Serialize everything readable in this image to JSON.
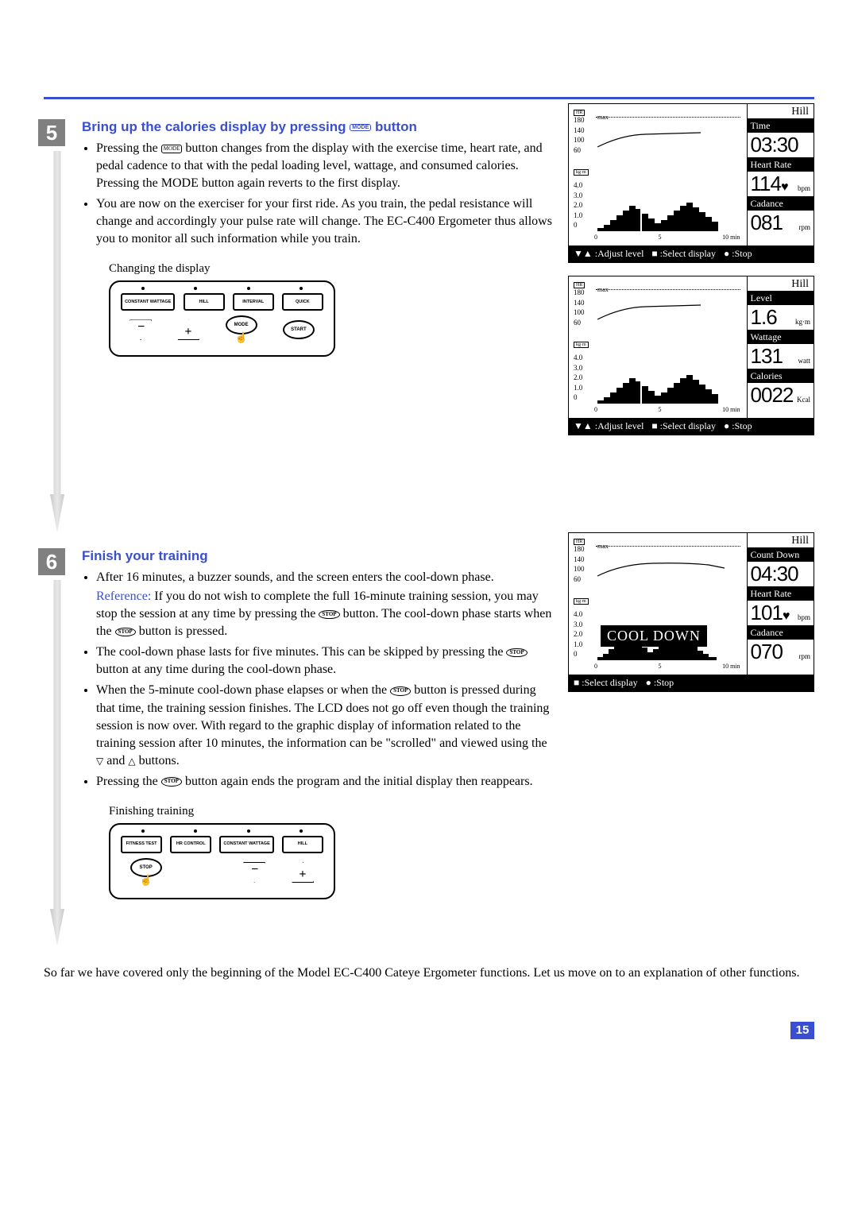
{
  "step5": {
    "number": "5",
    "title_pre": "Bring up the calories display by pressing ",
    "title_post": " button",
    "mode_icon": "MODE",
    "bullets": [
      "Pressing the MODE button changes from the display with the exercise time, heart rate, and pedal cadence to that with the pedal loading level, wattage, and consumed calories. Pressing the MODE button again reverts to the first display.",
      "You are now on the exerciser for your first ride. As you train, the pedal resistance will change and accordingly your pulse rate will change. The EC-C400 Ergometer thus allows you to monitor all such information while you train."
    ],
    "panel_caption": "Changing the display",
    "panel_top_buttons": [
      "CONSTANT WATTAGE",
      "HILL",
      "INTERVAL",
      "QUICK"
    ],
    "panel_bottom_buttons": [
      "−",
      "+",
      "MODE",
      "START"
    ]
  },
  "step6": {
    "number": "6",
    "title": "Finish your training",
    "bullet1": "After 16 minutes, a buzzer sounds, and the screen enters the cool-down phase.",
    "ref_label": "Reference:",
    "ref_text": " If you do not wish to complete the full 16-minute training session, you may stop the session at any time by pressing the STOP button. The cool-down phase starts when the STOP button is pressed.",
    "bullet2": "The cool-down phase lasts for five minutes. This can be skipped by pressing the STOP button at any time during the cool-down phase.",
    "bullet3": "When the 5-minute cool-down phase elapses or when the STOP button is pressed during that time, the training session finishes. The LCD does not go off even though the training session is now over. With regard to the graphic display of information related to the training session after 10 minutes, the information can be \"scrolled\" and viewed using the ▽ and △ buttons.",
    "bullet4": "Pressing the STOP button again ends the program and the initial display then reappears.",
    "panel_caption": "Finishing training",
    "panel_top_buttons": [
      "FITNESS TEST",
      "HR CONTROL",
      "CONSTANT WATTAGE",
      "HILL"
    ],
    "panel_stop": "STOP"
  },
  "lcd1": {
    "mode": "Hill",
    "hr_label": "HR",
    "max_label": "max",
    "hr_ticks": [
      "180",
      "140",
      "100",
      "60"
    ],
    "kgm_label": "kg·m",
    "kgm_ticks": [
      "4.0",
      "3.0",
      "2.0",
      "1.0",
      "0"
    ],
    "x_ticks": [
      "0",
      "5",
      "10"
    ],
    "x_unit": "min",
    "metrics": [
      {
        "label": "Time",
        "value": "03:30",
        "unit": ""
      },
      {
        "label": "Heart Rate",
        "value": "114",
        "unit": "bpm",
        "heart": true
      },
      {
        "label": "Cadance",
        "value": "081",
        "unit": "rpm"
      }
    ],
    "footer": [
      "▼▲ :Adjust level",
      "■ :Select display",
      "● :Stop"
    ]
  },
  "lcd2": {
    "mode": "Hill",
    "metrics": [
      {
        "label": "Level",
        "value": "1.6",
        "unit": "kg·m"
      },
      {
        "label": "Wattage",
        "value": "131",
        "unit": "watt"
      },
      {
        "label": "Calories",
        "value": "0022",
        "unit": "Kcal"
      }
    ],
    "footer": [
      "▼▲ :Adjust level",
      "■ :Select display",
      "● :Stop"
    ]
  },
  "lcd3": {
    "mode": "Hill",
    "cooldown": "COOL DOWN",
    "metrics": [
      {
        "label": "Count Down",
        "value": "04:30",
        "unit": ""
      },
      {
        "label": "Heart Rate",
        "value": "101",
        "unit": "bpm",
        "heart": true
      },
      {
        "label": "Cadance",
        "value": "070",
        "unit": "rpm"
      }
    ],
    "footer": [
      "■ :Select display",
      "● :Stop"
    ]
  },
  "closing": "So far we have covered only the beginning of the Model EC-C400 Cateye Ergometer functions. Let us move on to an explanation of other functions.",
  "page_number": "15",
  "chart_data": [
    {
      "type": "line+bar",
      "title": "HR and load vs time (display 1)",
      "hr_axis": {
        "ticks": [
          60,
          100,
          140,
          180
        ],
        "label": "HR"
      },
      "load_axis": {
        "ticks": [
          0,
          1.0,
          2.0,
          3.0,
          4.0
        ],
        "label": "kg·m"
      },
      "x_axis": {
        "ticks": [
          0,
          5,
          10
        ],
        "unit": "min"
      },
      "hr_series": [
        90,
        100,
        108,
        114,
        116,
        118,
        120
      ],
      "load_bars": [
        0.5,
        0.8,
        1.2,
        1.6,
        2.0,
        2.4,
        2.6,
        2.2,
        1.8,
        1.4,
        1.0,
        1.2,
        1.6,
        2.0,
        2.4,
        2.8,
        2.4,
        2.0,
        1.6,
        1.2
      ]
    },
    {
      "type": "line+bar",
      "title": "HR and load vs time (display 2)",
      "hr_series": [
        90,
        100,
        108,
        114,
        116,
        118,
        120
      ],
      "load_bars": [
        0.5,
        0.8,
        1.2,
        1.6,
        2.0,
        2.4,
        2.6,
        2.2,
        1.8,
        1.4,
        1.0,
        1.2,
        1.6,
        2.0,
        2.4,
        2.8,
        2.4,
        2.0,
        1.6,
        1.2
      ]
    },
    {
      "type": "line+bar",
      "title": "HR and load vs time (cool down)",
      "hr_series": [
        90,
        100,
        108,
        114,
        116,
        116,
        114,
        110,
        104,
        101
      ],
      "load_bars": [
        0.5,
        0.8,
        1.2,
        1.6,
        2.0,
        2.4,
        2.6,
        2.2,
        1.8,
        1.4,
        1.0,
        1.2,
        1.6,
        2.0,
        2.4,
        2.8,
        2.4,
        2.0,
        1.6,
        1.2,
        0.8,
        0.4
      ]
    }
  ]
}
